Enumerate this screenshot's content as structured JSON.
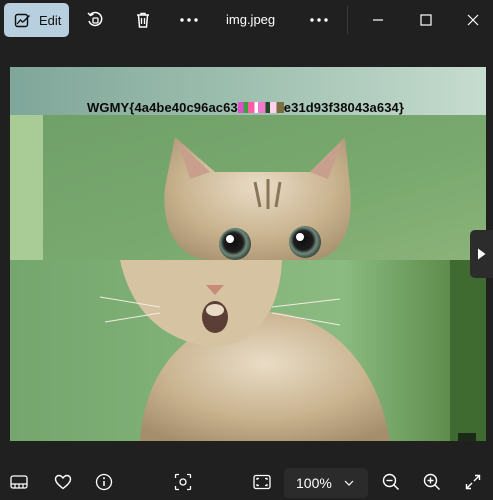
{
  "toolbar": {
    "edit_label": "Edit",
    "file_name": "img.jpeg"
  },
  "image": {
    "flag_text_left": "WGMY{4a4be40c96ac63",
    "flag_text_right": "e31d93f38043a634}"
  },
  "bottom": {
    "zoom_level": "100%"
  }
}
